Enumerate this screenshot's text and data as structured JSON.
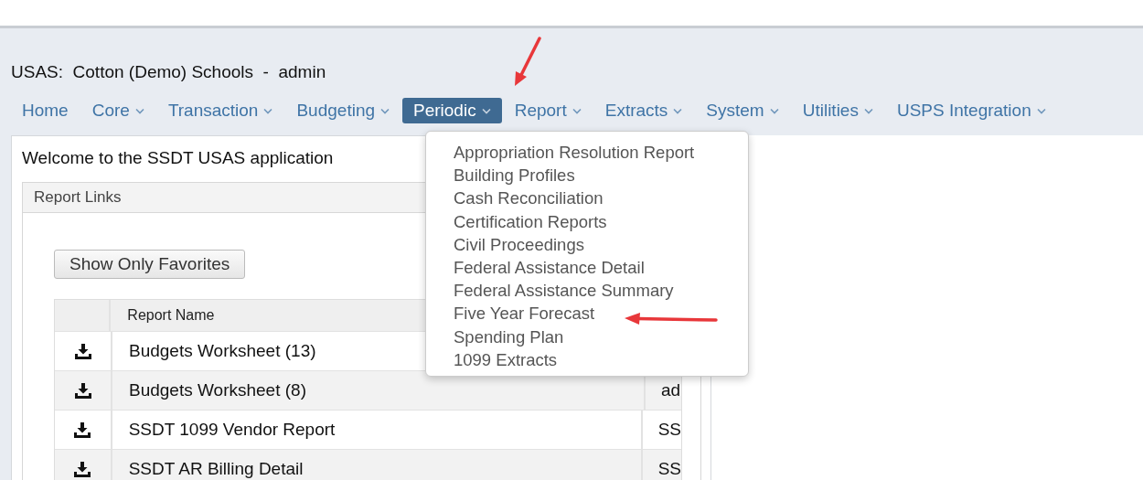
{
  "header": {
    "title": "USAS:  Cotton (Demo) Schools  -  admin"
  },
  "nav": [
    {
      "label": "Home",
      "dropdown": false,
      "selected": false
    },
    {
      "label": "Core",
      "dropdown": true,
      "selected": false
    },
    {
      "label": "Transaction",
      "dropdown": true,
      "selected": false
    },
    {
      "label": "Budgeting",
      "dropdown": true,
      "selected": false
    },
    {
      "label": "Periodic",
      "dropdown": true,
      "selected": true
    },
    {
      "label": "Report",
      "dropdown": true,
      "selected": false
    },
    {
      "label": "Extracts",
      "dropdown": true,
      "selected": false
    },
    {
      "label": "System",
      "dropdown": true,
      "selected": false
    },
    {
      "label": "Utilities",
      "dropdown": true,
      "selected": false
    },
    {
      "label": "USPS Integration",
      "dropdown": true,
      "selected": false
    }
  ],
  "welcome": "Welcome to the SSDT USAS application",
  "report_links": {
    "title": "Report Links",
    "button": "Show Only Favorites",
    "table": {
      "columns": [
        "",
        "Report Name"
      ],
      "rows": [
        {
          "name": "Budgets Worksheet (13)",
          "column_3": ""
        },
        {
          "name": "Budgets Worksheet (8)",
          "column_3": "ad"
        },
        {
          "name": "SSDT 1099 Vendor Report",
          "column_3": "SS"
        },
        {
          "name": "SSDT AR Billing Detail",
          "column_3": "SS"
        }
      ]
    }
  },
  "menu": {
    "items": [
      "Appropriation Resolution Report",
      "Building Profiles",
      "Cash Reconciliation",
      "Certification Reports",
      "Civil Proceedings",
      "Federal Assistance Detail",
      "Federal Assistance Summary",
      "Five Year Forecast",
      "Spending Plan",
      "1099 Extracts"
    ]
  }
}
